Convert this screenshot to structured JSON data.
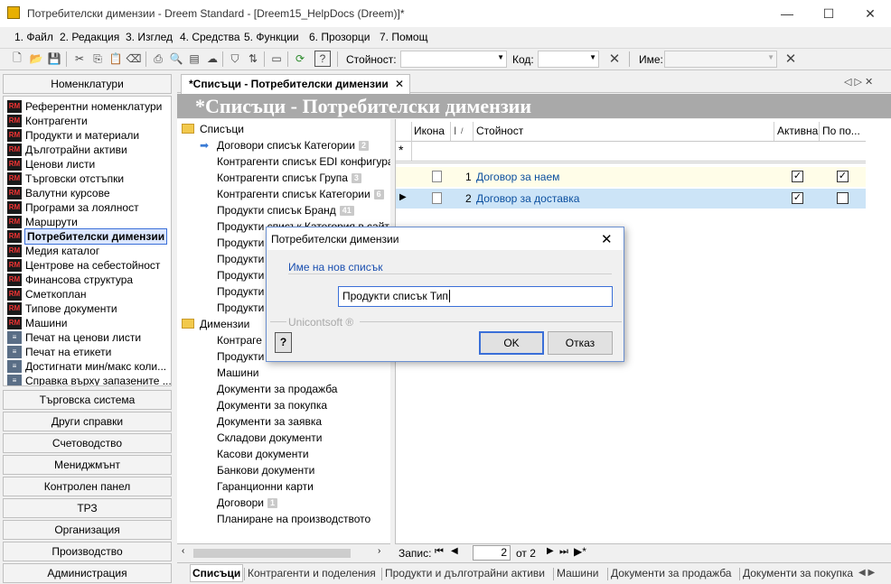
{
  "window": {
    "title": "Потребителски димензии - Dreem Standard - [Dreem15_HelpDocs (Dreem)]*",
    "minimize": "—",
    "maximize": "☐",
    "close": "✕"
  },
  "menu": [
    "1. Файл",
    "2. Редакция",
    "3. Изглед",
    "4. Средства",
    "5. Функции",
    "6. Прозорци",
    "7. Помощ"
  ],
  "toolbar": {
    "value_label": "Стойност:",
    "value": "",
    "code_label": "Код:",
    "code": "",
    "name_label": "Име:",
    "name": "",
    "clear_icon": "✕"
  },
  "sidebar": {
    "header": "Номенклатури",
    "items": [
      {
        "label": "Референтни номенклатури",
        "icon": "rm"
      },
      {
        "label": "Контрагенти",
        "icon": "rm"
      },
      {
        "label": "Продукти и материали",
        "icon": "rm"
      },
      {
        "label": "Дълготрайни активи",
        "icon": "rm"
      },
      {
        "label": "Ценови листи",
        "icon": "rm"
      },
      {
        "label": "Търговски отстъпки",
        "icon": "rm"
      },
      {
        "label": "Валутни курсове",
        "icon": "rm"
      },
      {
        "label": "Програми за лоялност",
        "icon": "rm"
      },
      {
        "label": "Маршрути",
        "icon": "rm"
      },
      {
        "label": "Потребителски димензии",
        "icon": "rm",
        "selected": true
      },
      {
        "label": "Медия каталог",
        "icon": "rm"
      },
      {
        "label": "Центрове на себестойност",
        "icon": "rm"
      },
      {
        "label": "Финансова структура",
        "icon": "rm"
      },
      {
        "label": "Сметкоплан",
        "icon": "rm"
      },
      {
        "label": "Типове документи",
        "icon": "rm"
      },
      {
        "label": "Машини",
        "icon": "rm"
      },
      {
        "label": "Печат на ценови листи",
        "icon": "ps"
      },
      {
        "label": "Печат на етикети",
        "icon": "ps"
      },
      {
        "label": "Достигнати мин/макс коли...",
        "icon": "ps"
      },
      {
        "label": "Справка върху запазените ...",
        "icon": "ps"
      }
    ],
    "groups": [
      "Търговска система",
      "Други справки",
      "Счетоводство",
      "Мениджмънт",
      "Контролен панел",
      "ТРЗ",
      "Организация",
      "Производство",
      "Администрация"
    ]
  },
  "doc_tab": {
    "label": "*Списъци - Потребителски димензии",
    "close": "✕",
    "nav": "◁ ▷ ✕"
  },
  "banner": "*Списъци - Потребителски димензии",
  "tree": {
    "root1": "Списъци",
    "lists": [
      {
        "label": "Договори списък Категории",
        "badge": "2",
        "current": true
      },
      {
        "label": "Контрагенти списък EDI конфигура",
        "badge": ""
      },
      {
        "label": "Контрагенти списък Група",
        "badge": "3"
      },
      {
        "label": "Контрагенти списък Категории",
        "badge": "6"
      },
      {
        "label": "Продукти списък Бранд",
        "badge": "41"
      },
      {
        "label": "Продукти списък Категория в сайт",
        "badge": ""
      },
      {
        "label": "Продукти",
        "badge": ""
      },
      {
        "label": "Продукти",
        "badge": ""
      },
      {
        "label": "Продукти",
        "badge": ""
      },
      {
        "label": "Продукти",
        "badge": ""
      },
      {
        "label": "Продукти",
        "badge": ""
      }
    ],
    "root2": "Димензии",
    "dims": [
      {
        "label": "Контраге",
        "badge": ""
      },
      {
        "label": "Продукти",
        "badge": ""
      },
      {
        "label": "Машини",
        "badge": ""
      },
      {
        "label": "Документи за продажба",
        "badge": ""
      },
      {
        "label": "Документи за покупка",
        "badge": ""
      },
      {
        "label": "Документи за заявка",
        "badge": ""
      },
      {
        "label": "Складови документи",
        "badge": ""
      },
      {
        "label": "Касови документи",
        "badge": ""
      },
      {
        "label": "Банкови документи",
        "badge": ""
      },
      {
        "label": "Гаранционни карти",
        "badge": ""
      },
      {
        "label": "Договори",
        "badge": "1"
      },
      {
        "label": "Планиране на производството",
        "badge": ""
      }
    ]
  },
  "grid": {
    "headers": {
      "icon": "Икона",
      "num": "I",
      "value": "Стойност",
      "active": "Активна",
      "default": "По по..."
    },
    "new_row_marker": "*",
    "rows": [
      {
        "num": "1",
        "value": "Договор за наем",
        "active": true,
        "default": true
      },
      {
        "num": "2",
        "value": "Договор за доставка",
        "active": true,
        "default": false
      }
    ]
  },
  "record_nav": {
    "label": "Запис:",
    "current": "2",
    "of_label": "от 2"
  },
  "bottom_tabs": [
    "Списъци",
    "Контрагенти и поделения",
    "Продукти и дълготрайни активи",
    "Машини",
    "Документи за продажба",
    "Документи за покупка"
  ],
  "dialog": {
    "title": "Потребителски димензии",
    "close": "✕",
    "field_label": "Име на нов списък",
    "field_value": "Продукти списък Тип",
    "brand": "Unicontsoft ®",
    "help_icon": "?",
    "ok": "OK",
    "cancel": "Отказ"
  },
  "colors": {
    "banner": "#a9a9a9",
    "selected_row": "#cce4f7",
    "link": "#0b4f9f",
    "accent": "#3a6fd8"
  }
}
